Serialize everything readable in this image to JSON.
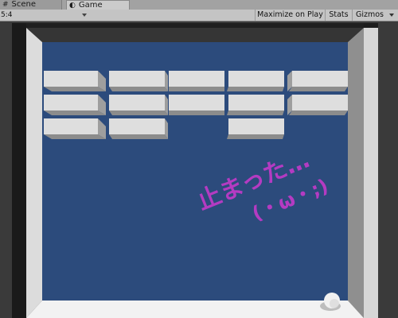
{
  "tabs": [
    {
      "label": "Scene",
      "icon": "hash-icon",
      "glyph": "#",
      "active": false
    },
    {
      "label": "Game",
      "icon": "game-tab-icon",
      "glyph": "◐",
      "active": true
    }
  ],
  "toolbar": {
    "aspect_label": "5:4",
    "maximize_label": "Maximize on Play",
    "stats_label": "Stats",
    "gizmos_label": "Gizmos"
  },
  "game": {
    "overlay_text_line1": "止まった…",
    "overlay_text_line2": "(・ω・;)",
    "overlay_color": "#b43bc2",
    "background_color": "#2c4b7c",
    "brick_rows": [
      5,
      5,
      3
    ]
  }
}
